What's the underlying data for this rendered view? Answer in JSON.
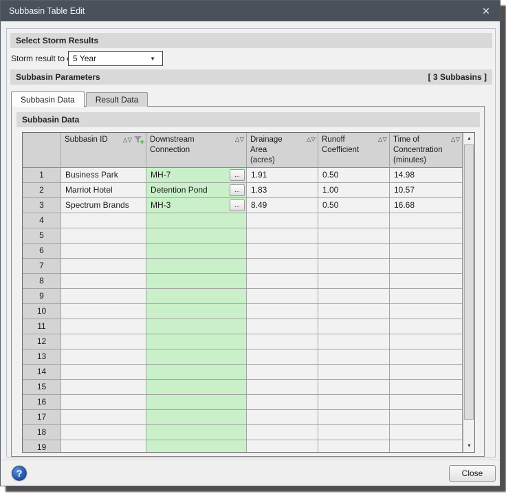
{
  "window": {
    "title": "Subbasin Table Edit"
  },
  "storm": {
    "section_header": "Select Storm Results",
    "label": "Storm result to display:",
    "selected": "5 Year"
  },
  "params": {
    "section_header": "Subbasin Parameters",
    "count": "[ 3 Subbasins ]"
  },
  "tabs": {
    "subbasin": "Subbasin Data",
    "result": "Result Data"
  },
  "grid_section": {
    "header": "Subbasin Data"
  },
  "table": {
    "columns": [
      {
        "key": "subbasin-id",
        "label": "Subbasin ID",
        "sortable": true,
        "filter": true
      },
      {
        "key": "downstream-connection",
        "label": "Downstream\nConnection",
        "sortable": true,
        "filter": false
      },
      {
        "key": "drainage-area",
        "label": "Drainage\nArea\n(acres)",
        "sortable": true,
        "filter": false
      },
      {
        "key": "runoff-coefficient",
        "label": "Runoff\nCoefficient",
        "sortable": true,
        "filter": false
      },
      {
        "key": "time-of-concentration",
        "label": "Time of\nConcentration\n(minutes)",
        "sortable": true,
        "filter": false
      }
    ],
    "rows": [
      {
        "num": "1",
        "id": "Business Park",
        "downstream": "MH-7",
        "browse": true,
        "area": "1.91",
        "runoff": "0.50",
        "time": "14.98"
      },
      {
        "num": "2",
        "id": "Marriot Hotel",
        "downstream": "Detention Pond",
        "browse": true,
        "area": "1.83",
        "runoff": "1.00",
        "time": "10.57"
      },
      {
        "num": "3",
        "id": "Spectrum Brands",
        "downstream": "MH-3",
        "browse": true,
        "area": "8.49",
        "runoff": "0.50",
        "time": "16.68"
      },
      {
        "num": "4",
        "id": "",
        "downstream": "",
        "browse": false,
        "area": "",
        "runoff": "",
        "time": ""
      },
      {
        "num": "5",
        "id": "",
        "downstream": "",
        "browse": false,
        "area": "",
        "runoff": "",
        "time": ""
      },
      {
        "num": "6",
        "id": "",
        "downstream": "",
        "browse": false,
        "area": "",
        "runoff": "",
        "time": ""
      },
      {
        "num": "7",
        "id": "",
        "downstream": "",
        "browse": false,
        "area": "",
        "runoff": "",
        "time": ""
      },
      {
        "num": "8",
        "id": "",
        "downstream": "",
        "browse": false,
        "area": "",
        "runoff": "",
        "time": ""
      },
      {
        "num": "9",
        "id": "",
        "downstream": "",
        "browse": false,
        "area": "",
        "runoff": "",
        "time": ""
      },
      {
        "num": "10",
        "id": "",
        "downstream": "",
        "browse": false,
        "area": "",
        "runoff": "",
        "time": ""
      },
      {
        "num": "11",
        "id": "",
        "downstream": "",
        "browse": false,
        "area": "",
        "runoff": "",
        "time": ""
      },
      {
        "num": "12",
        "id": "",
        "downstream": "",
        "browse": false,
        "area": "",
        "runoff": "",
        "time": ""
      },
      {
        "num": "13",
        "id": "",
        "downstream": "",
        "browse": false,
        "area": "",
        "runoff": "",
        "time": ""
      },
      {
        "num": "14",
        "id": "",
        "downstream": "",
        "browse": false,
        "area": "",
        "runoff": "",
        "time": ""
      },
      {
        "num": "15",
        "id": "",
        "downstream": "",
        "browse": false,
        "area": "",
        "runoff": "",
        "time": ""
      },
      {
        "num": "16",
        "id": "",
        "downstream": "",
        "browse": false,
        "area": "",
        "runoff": "",
        "time": ""
      },
      {
        "num": "17",
        "id": "",
        "downstream": "",
        "browse": false,
        "area": "",
        "runoff": "",
        "time": ""
      },
      {
        "num": "18",
        "id": "",
        "downstream": "",
        "browse": false,
        "area": "",
        "runoff": "",
        "time": ""
      },
      {
        "num": "19",
        "id": "",
        "downstream": "",
        "browse": false,
        "area": "",
        "runoff": "",
        "time": ""
      }
    ]
  },
  "footer": {
    "close": "Close"
  },
  "icons": {
    "close": "✕",
    "dropdown": "▼",
    "sort_asc": "△",
    "sort_desc": "▽",
    "filter_plus": "+",
    "ellipsis": "...",
    "scroll_up": "▲",
    "scroll_down": "▼",
    "help": "?"
  },
  "colors": {
    "titlebar": "#49525b",
    "section_bar": "#d9d9d9",
    "editable_cell_green": "#c9f0c9",
    "header_gray": "#d3d3d3",
    "help_blue": "#2b62b4"
  }
}
